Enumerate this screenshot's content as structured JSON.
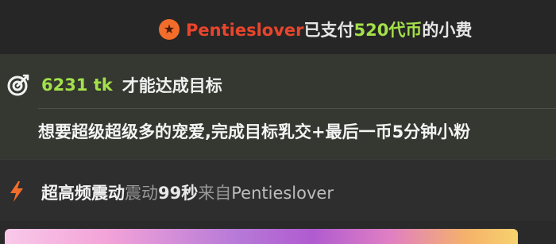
{
  "tip_message": {
    "user": "Pentieslover",
    "paid_text": "已支付",
    "amount": "520代币",
    "suffix": "的小费",
    "icon": "star-icon",
    "user_color": "#e8452c",
    "amount_color": "#a4e04a"
  },
  "goal": {
    "icon": "target-icon",
    "count": "6231 tk",
    "suffix": "才能达成目标",
    "description": "想要超级超级多的宠爱,完成目标乳交+最后一币5分钟小粉",
    "count_color": "#a4e04a"
  },
  "vibration": {
    "icon": "lightning-icon",
    "level": "超高频震动",
    "word": "震动",
    "duration": "99秒",
    "from": "来自",
    "user": "Pentieslover",
    "icon_color": "#f26d2b"
  }
}
